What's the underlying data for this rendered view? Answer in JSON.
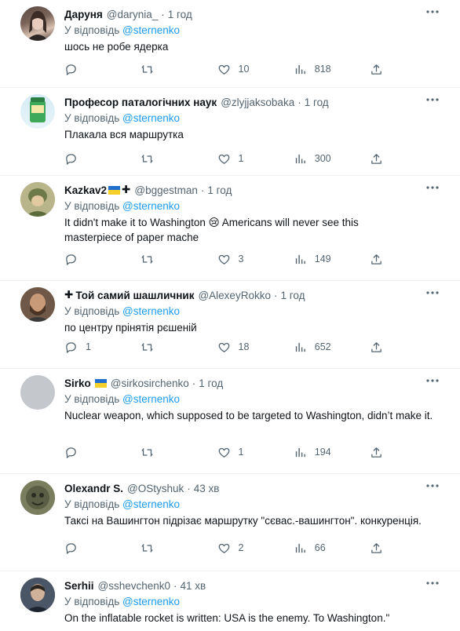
{
  "tweets": [
    {
      "name": "Даруня",
      "handle": "@darynia_",
      "time": "1 год",
      "reply_prefix": "У відповідь",
      "reply_to": "@sternenko",
      "text": "шось не робе ядерка",
      "stats": {
        "replies": "",
        "retweets": "",
        "likes": "10",
        "views": "818"
      }
    },
    {
      "name": "Професор паталогічних наук",
      "handle": "@zlyjjaksobaka",
      "time": "1 год",
      "reply_prefix": "У відповідь",
      "reply_to": "@sternenko",
      "text": "Плакала вся маршрутка",
      "stats": {
        "replies": "",
        "retweets": "",
        "likes": "1",
        "views": "300"
      }
    },
    {
      "name": "Kazkav2",
      "handle": "@bggestman",
      "time": "1 год",
      "reply_prefix": "У відповідь",
      "reply_to": "@sternenko",
      "text": "It didn't make it to Washington 😢 Americans will never see this masterpiece of paper mache",
      "stats": {
        "replies": "",
        "retweets": "",
        "likes": "3",
        "views": "149"
      }
    },
    {
      "name": "Той самий шашличник",
      "handle": "@AlexeyRokko",
      "time": "1 год",
      "reply_prefix": "У відповідь",
      "reply_to": "@sternenko",
      "text": "по центру прінятія рєшеній",
      "stats": {
        "replies": "1",
        "retweets": "",
        "likes": "18",
        "views": "652"
      }
    },
    {
      "name": "Sirko",
      "handle": "@sirkosirchenko",
      "time": "1 год",
      "reply_prefix": "У відповідь",
      "reply_to": "@sternenko",
      "text": "Nuclear weapon, which supposed to be targeted to Washington, didn’t make it.",
      "stats": {
        "replies": "",
        "retweets": "",
        "likes": "1",
        "views": "194"
      }
    },
    {
      "name": "Olexandr S.",
      "handle": "@OStyshuk",
      "time": "43 хв",
      "reply_prefix": "У відповідь",
      "reply_to": "@sternenko",
      "text": "Таксі на Вашингтон підрізає маршрутку \"сєвас.-вашингтон\". конкуренція.",
      "stats": {
        "replies": "",
        "retweets": "",
        "likes": "2",
        "views": "66"
      }
    },
    {
      "name": "Serhii",
      "handle": "@sshevchenk0",
      "time": "41 хв",
      "reply_prefix": "У відповідь",
      "reply_to": "@sternenko",
      "text": "On the inflatable rocket is written: USA is the enemy. To Washington.\"",
      "stats": {
        "replies": "",
        "retweets": "",
        "likes": "",
        "views": ""
      }
    }
  ],
  "colors": {
    "accent": "#1d9bf0",
    "muted": "#536471",
    "text": "#0f1419",
    "border": "#eff3f4"
  },
  "icons": [
    "reply-icon",
    "retweet-icon",
    "like-icon",
    "views-icon",
    "share-icon",
    "more-icon"
  ]
}
